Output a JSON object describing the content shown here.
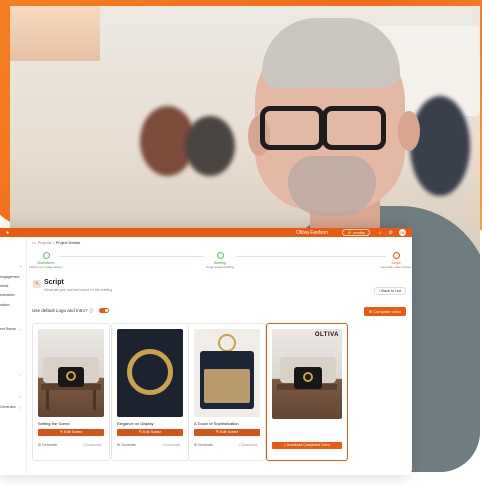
{
  "app": {
    "brand": "●",
    "workspace": "Oltiva Fashion",
    "credits": "⚡ credits",
    "avatar": "SK"
  },
  "sidebar": {
    "items": [
      {
        "label": "",
        "arrow": "⌄"
      },
      {
        "label": "engagement",
        "arrow": ""
      },
      {
        "label": "dests",
        "arrow": ""
      },
      {
        "label": "eneration",
        "arrow": ""
      },
      {
        "label": "nation",
        "arrow": ""
      },
      {
        "label": "ent Reuse",
        "arrow": "›"
      },
      {
        "label": "",
        "arrow": "›"
      },
      {
        "label": "",
        "arrow": "›"
      },
      {
        "label": "Generator",
        "arrow": "›"
      }
    ]
  },
  "breadcrumb": {
    "root": "Projects",
    "sep": ">",
    "current": "Project Details"
  },
  "steps": [
    {
      "title": "Brainstorm",
      "sub": "Refine your video design",
      "active": false
    },
    {
      "title": "Briefing",
      "sub": "AI-generated briefing",
      "active": false
    },
    {
      "title": "Script",
      "sub": "Generate video scenes",
      "active": true
    }
  ],
  "script": {
    "title": "Script",
    "subtitle": "Generate your scenes based on the briefing",
    "back_label": "Back to List",
    "toggle_label": "Use default Logo and Intro?",
    "info_icon": "ⓘ",
    "complete_label": "Complete video"
  },
  "cards": [
    {
      "name": "Setting the Scene",
      "edit": "Edit Scene",
      "generate": "Generate",
      "download": "Download",
      "selected": false
    },
    {
      "name": "Elegance on Display",
      "edit": "Edit Scene",
      "generate": "Generate",
      "download": "Download",
      "selected": false
    },
    {
      "name": "A Touch of Sophistication",
      "edit": "Edit Scene",
      "generate": "Generate",
      "download": "Download",
      "selected": false
    },
    {
      "name": "",
      "edit": "",
      "generate": "",
      "download_completed": "Download Completed Video",
      "logo": "OLTIVA",
      "selected": true
    }
  ],
  "colors": {
    "accent": "#e75b12",
    "background_orange": "#f5821f",
    "success": "#6cc36a"
  }
}
